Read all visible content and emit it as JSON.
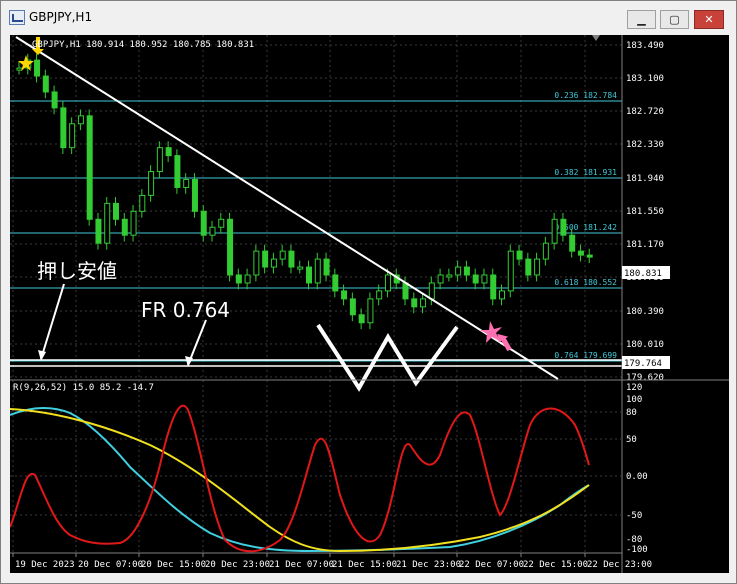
{
  "window": {
    "title": "GBPJPY,H1",
    "minimize": "▁",
    "maximize": "▢",
    "close": "✕"
  },
  "chart": {
    "symbol_header": "GBPJPY,H1  180.914 180.952 180.785 180.831",
    "current_price": "180.831",
    "price_ticks": [
      "183.490",
      "183.100",
      "182.720",
      "182.330",
      "181.940",
      "181.550",
      "181.170",
      "180.780",
      "180.390",
      "180.010",
      "179.620"
    ],
    "fib_levels": [
      {
        "label": "0.236",
        "price": "182.784"
      },
      {
        "label": "0.382",
        "price": "181.931"
      },
      {
        "label": "0.500",
        "price": "181.242"
      },
      {
        "label": "0.618",
        "price": "180.552"
      },
      {
        "label": "0.764",
        "price": "179.699"
      }
    ],
    "level_marker": "179.764",
    "annotations": {
      "pushback": "押し安値",
      "fr": "FR 0.764"
    },
    "indicator_header": "R(9,26,52) 15.0 85.2 -14.7",
    "indicator_ticks": [
      "120",
      "100",
      "80",
      "50",
      "0.00",
      "-50",
      "-80",
      "-100"
    ],
    "time_labels": [
      "19 Dec 2023",
      "20 Dec 07:00",
      "20 Dec 15:00",
      "20 Dec 23:00",
      "21 Dec 07:00",
      "21 Dec 15:00",
      "21 Dec 23:00",
      "22 Dec 07:00",
      "22 Dec 15:00",
      "22 Dec 23:00"
    ]
  },
  "colors": {
    "bg": "#000000",
    "candle": "#33cc33",
    "grid": "#3a3a3a",
    "fib": "#40c8d8",
    "red": "#e01818",
    "cyan": "#40d0e0",
    "yellow": "#f0e020",
    "white": "#ffffff"
  }
}
